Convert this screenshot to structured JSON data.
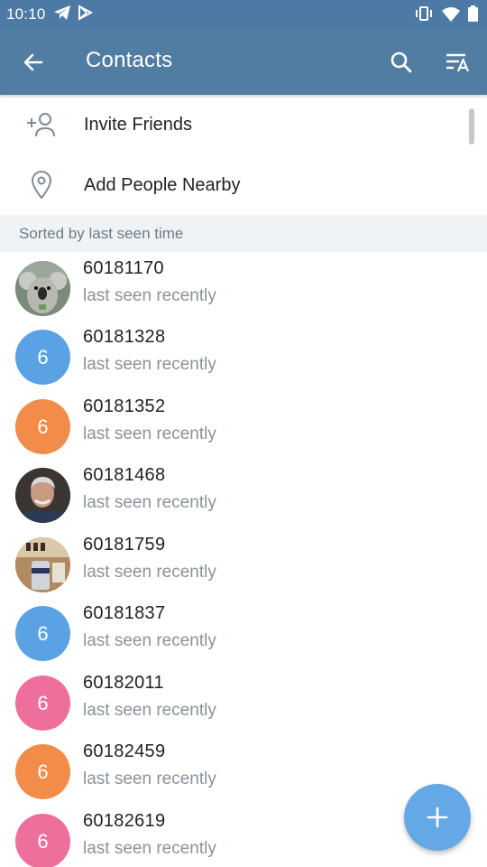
{
  "status_bar": {
    "time": "10:10",
    "left_icons": [
      "telegram-icon",
      "play-store-icon"
    ],
    "right_icons": [
      "vibrate-icon",
      "wifi-icon",
      "battery-icon"
    ]
  },
  "app_bar": {
    "title": "Contacts",
    "back_icon": "arrow-back-icon",
    "search_icon": "search-icon",
    "sort_icon": "sort-by-name-icon"
  },
  "actions": [
    {
      "label": "Invite Friends",
      "icon": "add-person-icon"
    },
    {
      "label": "Add People Nearby",
      "icon": "location-pin-icon"
    }
  ],
  "section_header": "Sorted by last seen time",
  "contacts": [
    {
      "name": "60181170",
      "status": "last seen recently",
      "avatar_type": "photo",
      "avatar_desc": "koala-photo",
      "color": "#8a9a8c"
    },
    {
      "name": "60181328",
      "status": "last seen recently",
      "avatar_type": "initial",
      "initial": "6",
      "color": "#5aa2e3"
    },
    {
      "name": "60181352",
      "status": "last seen recently",
      "avatar_type": "initial",
      "initial": "6",
      "color": "#f28c48"
    },
    {
      "name": "60181468",
      "status": "last seen recently",
      "avatar_type": "photo",
      "avatar_desc": "man-photo",
      "color": "#4a4540"
    },
    {
      "name": "60181759",
      "status": "last seen recently",
      "avatar_type": "photo",
      "avatar_desc": "beer-can-photo",
      "color": "#a8825a"
    },
    {
      "name": "60181837",
      "status": "last seen recently",
      "avatar_type": "initial",
      "initial": "6",
      "color": "#5aa2e3"
    },
    {
      "name": "60182011",
      "status": "last seen recently",
      "avatar_type": "initial",
      "initial": "6",
      "color": "#ef6f9c"
    },
    {
      "name": "60182459",
      "status": "last seen recently",
      "avatar_type": "initial",
      "initial": "6",
      "color": "#f28c48"
    },
    {
      "name": "60182619",
      "status": "last seen recently",
      "avatar_type": "initial",
      "initial": "6",
      "color": "#ef6f9c"
    }
  ],
  "fab_icon": "plus-icon",
  "colors": {
    "app_bar": "#517da2",
    "status_bar": "#4d7aa5",
    "fab": "#64a9e6",
    "section_header_bg": "#f0f3f5"
  }
}
